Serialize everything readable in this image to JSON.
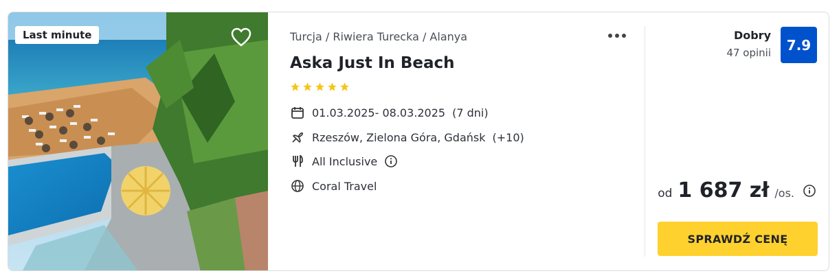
{
  "badge": {
    "label": "Last minute"
  },
  "hotel": {
    "location": "Turcja / Riwiera Turecka / Alanya",
    "name": "Aska Just In Beach",
    "stars": 5
  },
  "details": {
    "dates": "01.03.2025- 08.03.2025",
    "duration": "(7 dni)",
    "departure": "Rzeszów, Zielona Góra, Gdańsk",
    "departure_extra": "(+10)",
    "board": "All Inclusive",
    "operator": "Coral Travel"
  },
  "rating": {
    "label": "Dobry",
    "opinions": "47 opinii",
    "score": "7.9"
  },
  "price": {
    "prefix": "od",
    "amount": "1 687 zł",
    "suffix": "/os."
  },
  "cta": {
    "label": "SPRAWDŹ CENĘ"
  },
  "colors": {
    "accent_yellow": "#ffd12e",
    "score_blue": "#0052cc",
    "star_yellow": "#f5c518"
  },
  "icons": [
    "heart-icon",
    "more-dots-icon",
    "calendar-icon",
    "plane-icon",
    "cutlery-icon",
    "info-icon",
    "globe-icon"
  ]
}
